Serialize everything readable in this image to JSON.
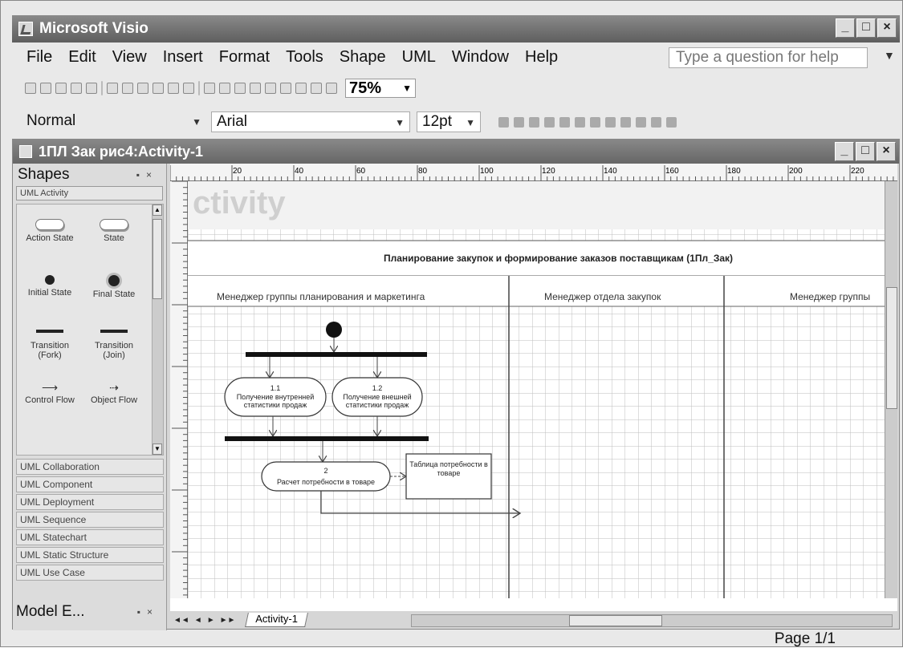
{
  "app": {
    "title": "Microsoft Visio",
    "window_buttons": [
      "_",
      "□",
      "×"
    ]
  },
  "menu": {
    "items": [
      "File",
      "Edit",
      "View",
      "Insert",
      "Format",
      "Tools",
      "Shape",
      "UML",
      "Window",
      "Help"
    ]
  },
  "help": {
    "placeholder": "Type a question for help"
  },
  "toolbar": {
    "zoom": "75%"
  },
  "format_bar": {
    "style": "Normal",
    "font": "Arial",
    "size": "12pt"
  },
  "document": {
    "title": "1ПЛ  Зак  рис4:Activity-1",
    "window_buttons": [
      "_",
      "□",
      "×"
    ]
  },
  "shapes_panel": {
    "title": "Shapes",
    "active_stencil": "UML Activity",
    "items": [
      {
        "label": "Action State",
        "icon": "action-state-icon"
      },
      {
        "label": "State",
        "icon": "state-icon"
      },
      {
        "label": "Initial State",
        "icon": "initial-state-icon"
      },
      {
        "label": "Final State",
        "icon": "final-state-icon"
      },
      {
        "label": "Transition (Fork)",
        "icon": "fork-icon"
      },
      {
        "label": "Transition (Join)",
        "icon": "join-icon"
      },
      {
        "label": "Control Flow",
        "icon": "control-flow-icon"
      },
      {
        "label": "Object Flow",
        "icon": "object-flow-icon"
      }
    ],
    "stencils": [
      "UML Collaboration",
      "UML Component",
      "UML Deployment",
      "UML Sequence",
      "UML Statechart",
      "UML Static Structure",
      "UML Use Case"
    ],
    "model_explorer": "Model E..."
  },
  "ruler": {
    "top_labels": [
      "20",
      "40",
      "60",
      "80",
      "100",
      "120",
      "140",
      "160",
      "180",
      "200",
      "220"
    ]
  },
  "diagram": {
    "watermark": "ctivity",
    "title": "Планирование закупок и формирование заказов поставщикам (1Пл_Зак)",
    "lanes": [
      "Менеджер группы планирования и маркетинга",
      "Менеджер отдела закупок",
      "Менеджер группы"
    ],
    "activities": [
      {
        "num": "1.1",
        "text": "Получение внутренней статистики продаж"
      },
      {
        "num": "1.2",
        "text": "Получение внешней статистики продаж"
      },
      {
        "num": "2",
        "text": "Расчет потребности в товаре"
      }
    ],
    "object": {
      "text": "Таблица потребности в товаре"
    }
  },
  "tabs": {
    "active": "Activity-1",
    "nav": [
      "◄◄",
      "◄",
      "►",
      "►►"
    ]
  },
  "status": {
    "page": "Page 1/1"
  }
}
